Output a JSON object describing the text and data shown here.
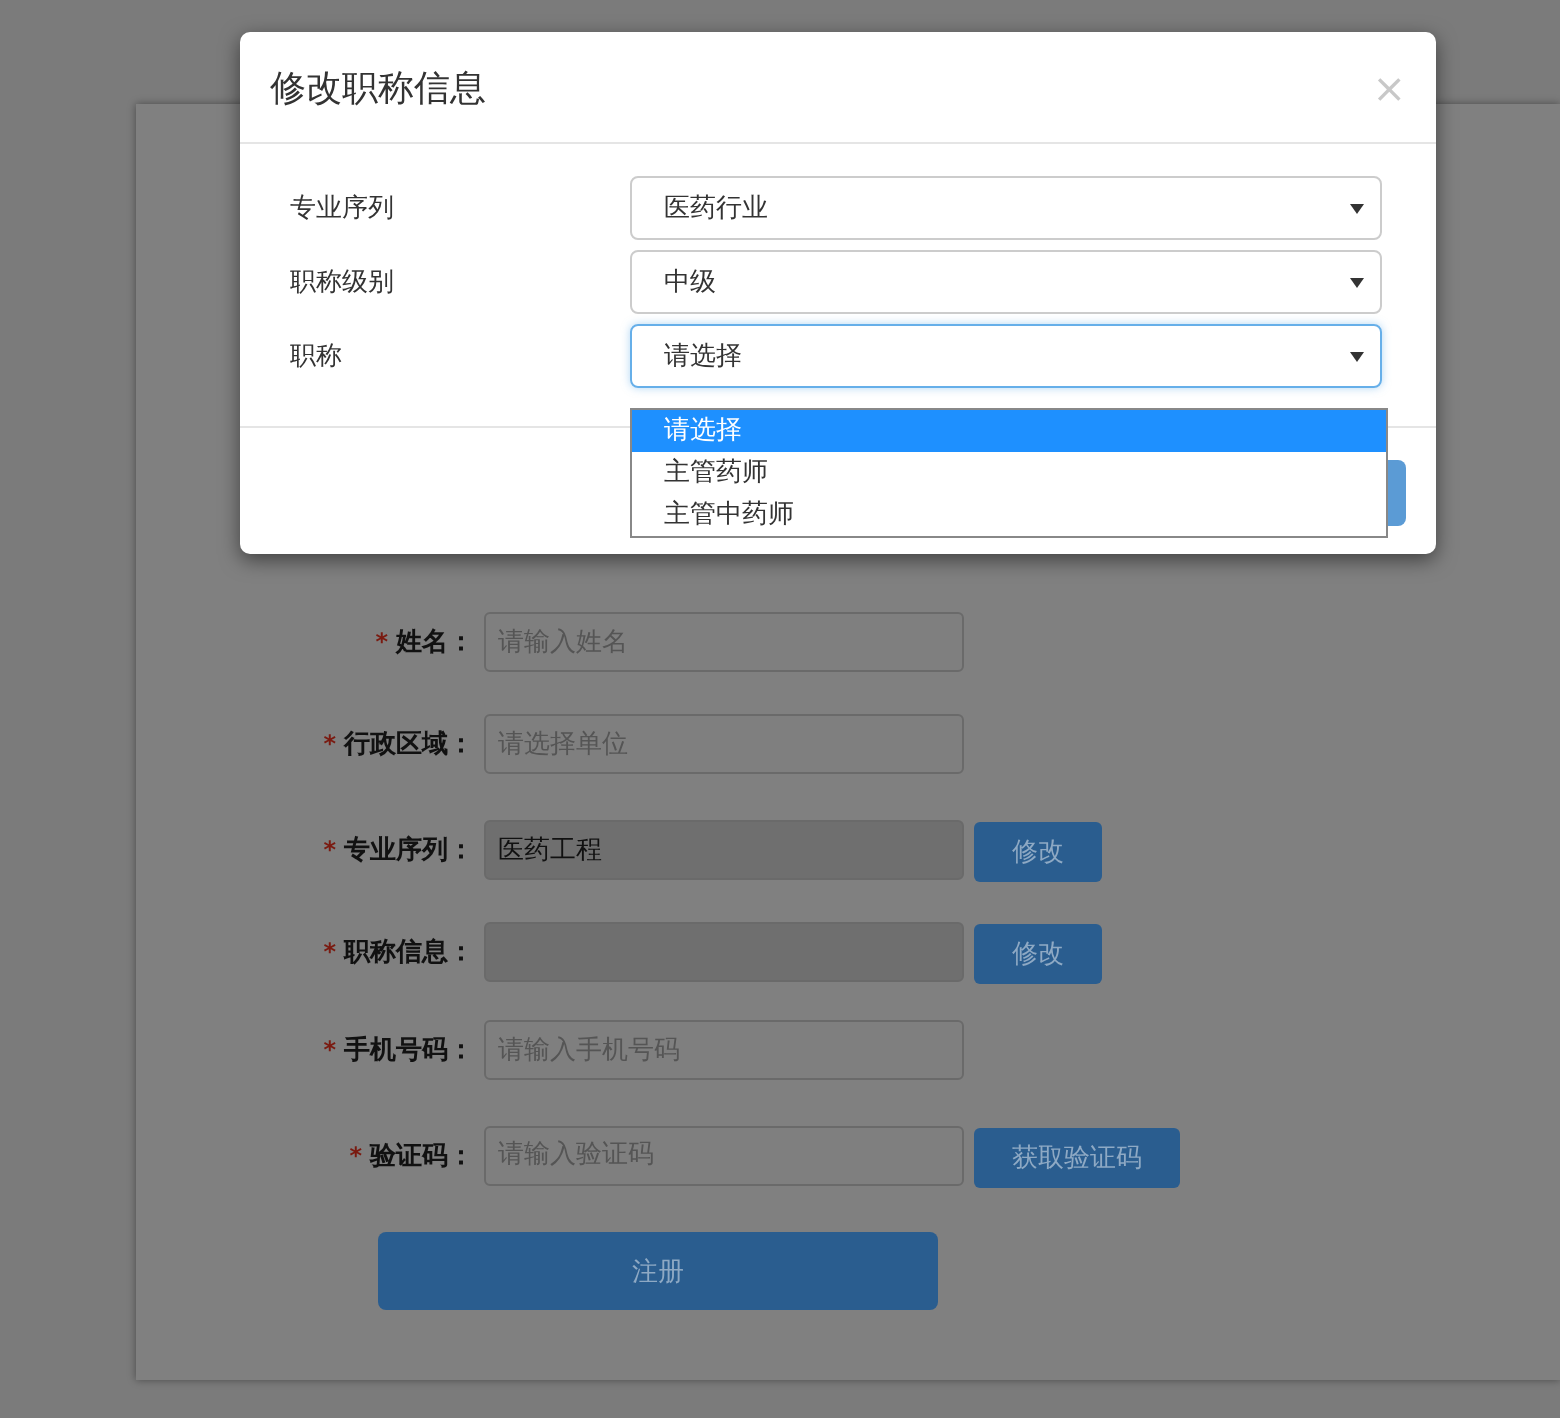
{
  "form": {
    "fields": [
      {
        "mark": "*",
        "label": "姓名：",
        "placeholder": "请输入姓名",
        "disabled": false
      },
      {
        "mark": "*",
        "label": "行政区域：",
        "placeholder": "请选择单位",
        "disabled": false
      },
      {
        "mark": "*",
        "label": "专业序列：",
        "value": "医药工程",
        "disabled": true,
        "button": "修改"
      },
      {
        "mark": "*",
        "label": "职称信息：",
        "disabled": true,
        "button": "修改"
      },
      {
        "mark": "*",
        "label": "手机号码：",
        "placeholder": "请输入手机号码",
        "disabled": false
      },
      {
        "mark": "*",
        "label": "验证码：",
        "placeholder": "请输入验证码",
        "disabled": false,
        "button": "获取验证码"
      }
    ],
    "submit": "注册"
  },
  "dialog": {
    "title": "修改职称信息",
    "close": "×",
    "fields": [
      {
        "label": "专业序列",
        "value": "医药行业",
        "expanded": false
      },
      {
        "label": "职称级别",
        "value": "中级",
        "expanded": false
      },
      {
        "label": "职称",
        "value": "请选择",
        "expanded": true,
        "options": [
          {
            "label": "请选择",
            "selected": true
          },
          {
            "label": "主管药师",
            "selected": false
          },
          {
            "label": "主管中药师",
            "selected": false
          }
        ]
      }
    ]
  }
}
